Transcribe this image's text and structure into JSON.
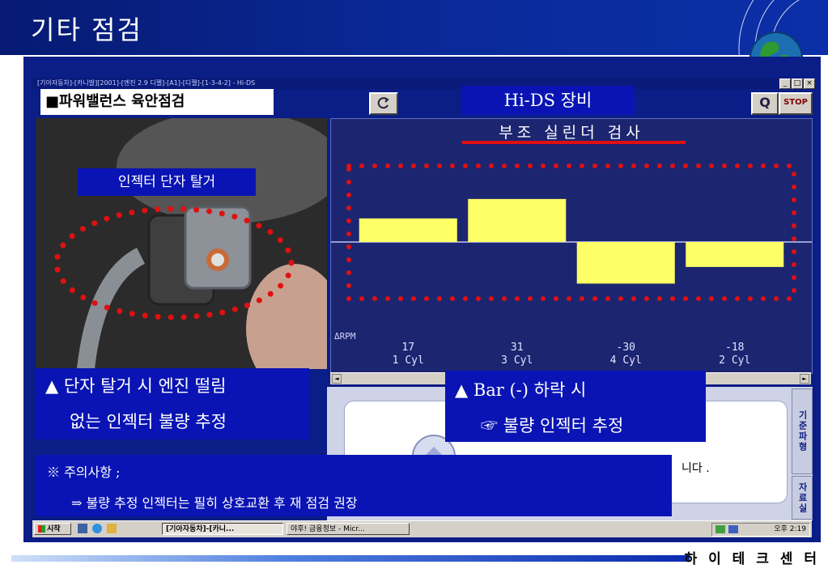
{
  "slide": {
    "title": "기타 점검",
    "footer": "하 이 테 크 센 터"
  },
  "window": {
    "titlebar": "[기아자동차]-[카니발][2001]-[엔진 2.9 디젤]-[A1]-[디젤]-[1-3-4-2] - Hi-DS",
    "controls": [
      "_",
      "□",
      "×"
    ]
  },
  "toolbar": {
    "section_tag": "■파워밸런스 육안점검",
    "device_tag": "Hi-DS 장비",
    "refresh_icon": "refresh-icon",
    "q_label": "Q",
    "stop_label": "STOP"
  },
  "photo": {
    "caption": "인젝터 단자 탈거"
  },
  "chart_title": "부조 실린더 검사",
  "chart_data": {
    "type": "bar",
    "title": "부조 실린더 검사",
    "ylabel": "ΔRPM",
    "categories": [
      "1 Cyl",
      "3 Cyl",
      "4 Cyl",
      "2 Cyl"
    ],
    "values": [
      17,
      31,
      -30,
      -18
    ],
    "ylim": [
      -56,
      56
    ],
    "bar_color": "#ffff66",
    "grid": false
  },
  "callouts": {
    "left_line1": "▲ 단자 탈거 시 엔진 떨림",
    "left_line2": "없는 인젝터 불량 추정",
    "right_line1": "▲  Bar (-) 하락 시",
    "right_line2": "☞ 불량 인젝터 추정",
    "note_line1": "※ 주의사항 ;",
    "note_line2": "⇒ 불량 추정 인젝터는 필히 상호교환 후 재 점검 권장"
  },
  "lower_panel": {
    "partial_text": "니다 .",
    "side_tab_1": "기준파형",
    "side_tab_2": "자료실"
  },
  "taskbar": {
    "start_label": "시작",
    "task_1": "[기아자동차]-[카니...",
    "task_2": "야후! 금융정보 - Micr...",
    "clock": "오후 2:19"
  },
  "colors": {
    "header_blue": "#0a2a9a",
    "callout_blue": "#0a14b4",
    "chart_bg": "#1c2570",
    "bar_yellow": "#ffff66",
    "dotted_red": "#e01010"
  }
}
